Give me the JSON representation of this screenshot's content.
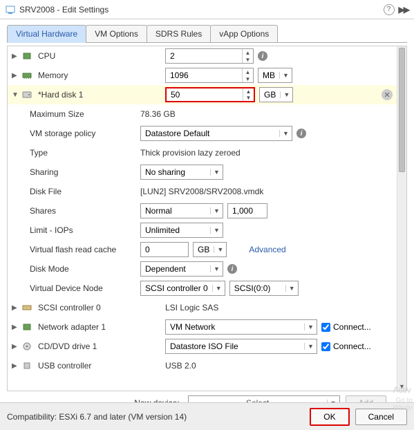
{
  "titlebar": {
    "title": "SRV2008 - Edit Settings"
  },
  "tabs": {
    "virtual_hardware": "Virtual Hardware",
    "vm_options": "VM Options",
    "sdrs_rules": "SDRS Rules",
    "vapp_options": "vApp Options"
  },
  "rows": {
    "cpu": {
      "label": "CPU",
      "value": "2"
    },
    "memory": {
      "label": "Memory",
      "value": "1096",
      "unit": "MB"
    },
    "harddisk": {
      "label": "*Hard disk 1",
      "value": "50",
      "unit": "GB"
    },
    "maxsize": {
      "label": "Maximum Size",
      "value": "78.36 GB"
    },
    "vmpolicy": {
      "label": "VM storage policy",
      "value": "Datastore Default"
    },
    "type": {
      "label": "Type",
      "value": "Thick provision lazy zeroed"
    },
    "sharing": {
      "label": "Sharing",
      "value": "No sharing"
    },
    "diskfile": {
      "label": "Disk File",
      "value": "[LUN2] SRV2008/SRV2008.vmdk"
    },
    "shares": {
      "label": "Shares",
      "value": "Normal",
      "num": "1,000"
    },
    "limit": {
      "label": "Limit - IOPs",
      "value": "Unlimited"
    },
    "flash": {
      "label": "Virtual flash read cache",
      "value": "0",
      "unit": "GB",
      "advanced": "Advanced"
    },
    "diskmode": {
      "label": "Disk Mode",
      "value": "Dependent"
    },
    "vdn": {
      "label": "Virtual Device Node",
      "ctrl": "SCSI controller 0",
      "pos": "SCSI(0:0)"
    },
    "scsi": {
      "label": "SCSI controller 0",
      "value": "LSI Logic SAS"
    },
    "net": {
      "label": "Network adapter 1",
      "value": "VM Network",
      "connect": "Connect..."
    },
    "cdrom": {
      "label": "CD/DVD drive 1",
      "value": "Datastore ISO File",
      "connect": "Connect..."
    },
    "usb": {
      "label": "USB controller",
      "value": "USB 2.0"
    }
  },
  "newdevice": {
    "label": "New device:",
    "select": "------- Select -------",
    "add": "Add"
  },
  "footer": {
    "compat": "Compatibility: ESXi 6.7 and later (VM version 14)",
    "ok": "OK",
    "cancel": "Cancel"
  },
  "watermark": {
    "line1": "Activ",
    "line2": "Go to",
    "line3": "Windo"
  }
}
